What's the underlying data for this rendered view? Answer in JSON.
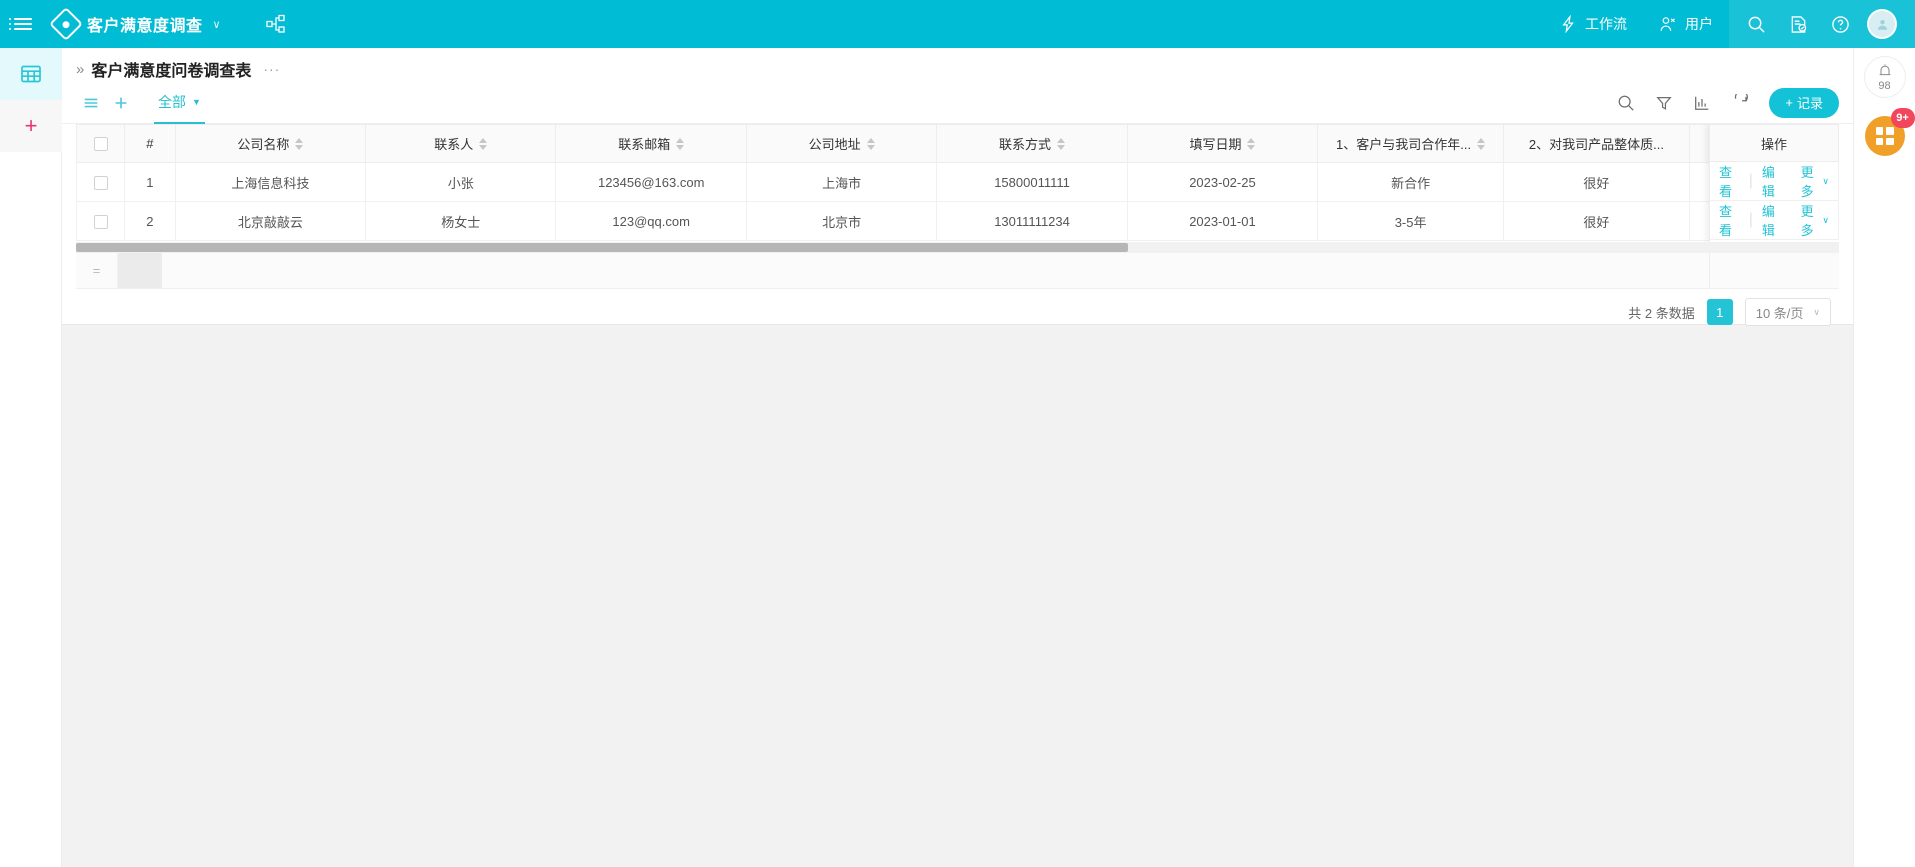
{
  "topbar": {
    "menu_icon": "hamburger-icon",
    "logo_icon": "diamond-logo-icon",
    "app_name": "客户满意度调查",
    "app_caret": "∨",
    "flow_icon": "org-chart-icon",
    "nav": [
      {
        "label": "工作流",
        "icon": "workflow-icon"
      },
      {
        "label": "用户",
        "icon": "users-icon"
      }
    ],
    "actions": [
      {
        "icon": "search-icon"
      },
      {
        "icon": "document-check-icon"
      },
      {
        "icon": "help-circle-icon"
      }
    ],
    "avatar_icon": "avatar",
    "background_color": "#00bcd4"
  },
  "left_rail": {
    "items": [
      {
        "icon": "table-grid-icon",
        "active": true
      },
      {
        "icon": "plus-icon",
        "label": "+",
        "active": false
      }
    ],
    "active_color": "#29c6d6",
    "plus_color": "#e8336d"
  },
  "right_rail": {
    "bell_icon": "bell-icon",
    "bell_count": "98",
    "apps_icon": "apps-grid-icon",
    "apps_badge": "9+",
    "apps_color": "#f0a028",
    "badge_color": "#f1465c"
  },
  "page": {
    "expand_icon": "double-chevron-right-icon",
    "title": "客户满意度问卷调查表",
    "more_dots": "···"
  },
  "toolbar": {
    "list_icon": "list-view-icon",
    "add_view_icon": "plus-icon",
    "tab_label": "全部",
    "tab_caret": "▼",
    "right_icons": [
      {
        "icon": "search-icon"
      },
      {
        "icon": "filter-funnel-icon"
      },
      {
        "icon": "bar-chart-icon"
      },
      {
        "icon": "refresh-icon"
      }
    ],
    "add_record_label": "记录",
    "add_record_plus": "+",
    "accent_color": "#13c2d6"
  },
  "table": {
    "columns": [
      {
        "key": "checkbox",
        "label": "",
        "sortable": false,
        "width_class": "col-cb"
      },
      {
        "key": "index",
        "label": "#",
        "sortable": false,
        "width_class": "col-idx"
      },
      {
        "key": "company",
        "label": "公司名称",
        "sortable": true,
        "width_class": "col-std"
      },
      {
        "key": "contact",
        "label": "联系人",
        "sortable": true,
        "width_class": "col-std"
      },
      {
        "key": "email",
        "label": "联系邮箱",
        "sortable": true,
        "width_class": "col-std"
      },
      {
        "key": "address",
        "label": "公司地址",
        "sortable": true,
        "width_class": "col-std"
      },
      {
        "key": "phone",
        "label": "联系方式",
        "sortable": true,
        "width_class": "col-std"
      },
      {
        "key": "date",
        "label": "填写日期",
        "sortable": true,
        "width_class": "col-std"
      },
      {
        "key": "q1",
        "label": "1、客户与我司合作年...",
        "sortable": true,
        "width_class": "col-q"
      },
      {
        "key": "q2",
        "label": "2、对我司产品整体质...",
        "sortable": false,
        "width_class": "col-q"
      }
    ],
    "actions_header": "操作",
    "rows": [
      {
        "index": "1",
        "company": "上海信息科技",
        "contact": "小张",
        "email": "123456@163.com",
        "address": "上海市",
        "phone": "15800011111",
        "date": "2023-02-25",
        "q1": "新合作",
        "q2": "很好"
      },
      {
        "index": "2",
        "company": "北京敲敲云",
        "contact": "杨女士",
        "email": "123@qq.com",
        "address": "北京市",
        "phone": "13011111234",
        "date": "2023-01-01",
        "q1": "3-5年",
        "q2": "很好"
      }
    ],
    "row_actions": {
      "view": "查看",
      "edit": "编辑",
      "more": "更多",
      "more_caret": "∨",
      "separator": "|"
    },
    "summary_symbol": "="
  },
  "pagination": {
    "total_text": "共 2 条数据",
    "current_page": "1",
    "page_size_label": "10 条/页",
    "page_size_caret": "∨"
  }
}
